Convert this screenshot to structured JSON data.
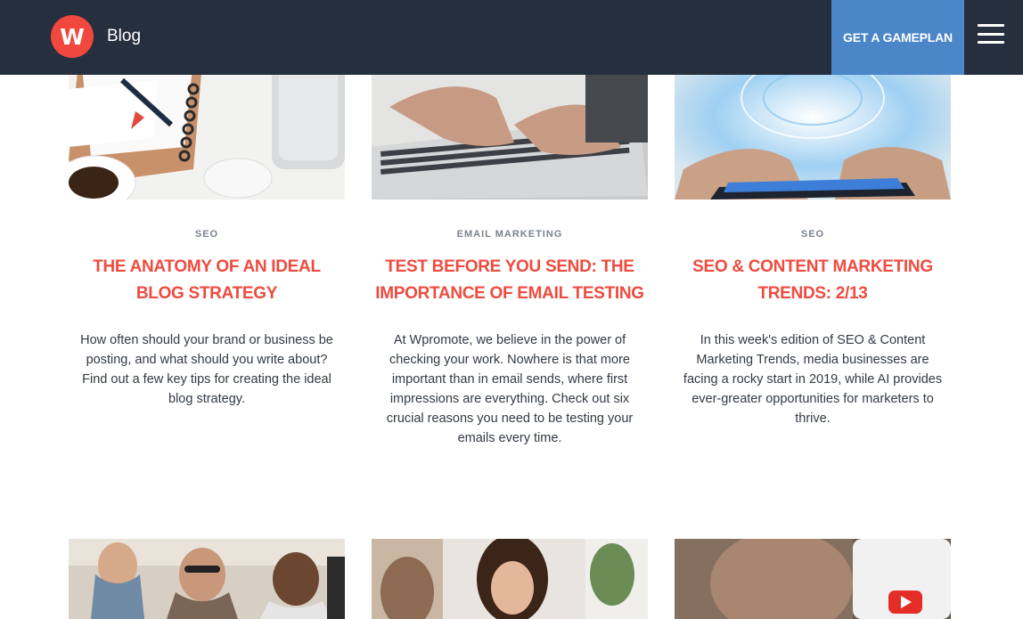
{
  "header": {
    "logo_letter": "W",
    "title": "Blog",
    "cta_label": "GET A GAMEPLAN",
    "menu_icon": "hamburger-menu-icon"
  },
  "posts": [
    {
      "category": "SEO",
      "title": "THE ANATOMY OF AN IDEAL BLOG STRATEGY",
      "excerpt": "How often should your brand or business be posting, and what should you write about? Find out a few key tips for creating the ideal blog strategy.",
      "image": "notebook-pen-coffee-photo"
    },
    {
      "category": "EMAIL MARKETING",
      "title": "TEST BEFORE YOU SEND: THE IMPORTANCE OF EMAIL TESTING",
      "excerpt": "At Wpromote, we believe in the power of checking your work. Nowhere is that more important than in email sends, where first impressions are everything. Check out six crucial reasons you need to be testing your emails every time.",
      "image": "hands-typing-laptop-photo"
    },
    {
      "category": "SEO",
      "title": "SEO & CONTENT MARKETING TRENDS: 2/13",
      "excerpt": "In this week's edition of SEO & Content Marketing Trends, media businesses are facing a rocky start in 2019, while AI provides ever-greater opportunities for marketers to thrive.",
      "image": "ai-brain-smartphone-photo"
    }
  ],
  "next_row_images": [
    "team-clapping-photo",
    "woman-smiling-meeting-photo",
    "smartphone-youtube-photo"
  ],
  "colors": {
    "header_bg": "#262f3d",
    "accent": "#ef4b3f",
    "cta_bg": "#4b86c8",
    "category_text": "#7b8290"
  }
}
